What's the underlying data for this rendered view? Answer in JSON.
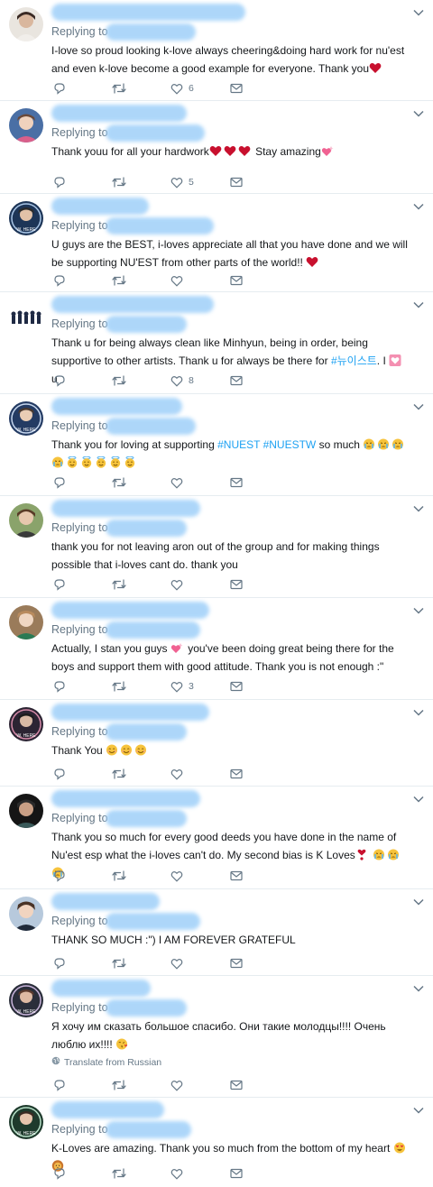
{
  "replying_to_label": "Replying to",
  "translate_label": "Translate from Russian",
  "tweets": [
    {
      "text": "I-love so proud looking k-love always cheering&doing hard work for nu'est and even k-love become a good example for everyone. Thank you",
      "like_count": "6"
    },
    {
      "text": "Thank youu for all your hardwork",
      "text_b": "Stay amazing",
      "like_count": "5"
    },
    {
      "text": "U guys are the BEST, i-loves appreciate all that you have done and we will be supporting NU'EST from other parts of the world!!",
      "like_count": ""
    },
    {
      "text": "Thank u for being always clean like Minhyun, being in order, being supportive to other artists. Thank u for always be there for",
      "hashtag": "#뉴이스트",
      "text_b": ". I",
      "text_c": "u",
      "like_count": "8"
    },
    {
      "text": "Thank you for loving at supporting",
      "hashtag": "#NUEST #NUESTW",
      "text_b": "so much",
      "like_count": ""
    },
    {
      "text": "thank you for not leaving aron out of the group and for making things possible that i-loves cant do. thank you",
      "like_count": ""
    },
    {
      "text": "Actually, I stan you guys",
      "text_b": "you've been doing great being there for the boys and support them with good attitude. Thank you is not enough :\"",
      "like_count": "3"
    },
    {
      "text": "Thank You",
      "like_count": ""
    },
    {
      "text": "Thank you so much for every good deeds you have done in the name of Nu'est esp what the i-loves can't do. My second bias is K Loves",
      "like_count": ""
    },
    {
      "text": "THANK SO MUCH :\") I AM FOREVER GRATEFUL",
      "like_count": ""
    },
    {
      "text": "Я хочу им сказать большое спасибо. Они такие молодцы!!!! Очень люблю их!!!!",
      "like_count": ""
    },
    {
      "text": "K-Loves are amazing. Thank you so much from the bottom of my heart",
      "like_count": ""
    }
  ],
  "colors": {
    "text": "#14171a",
    "secondary": "#657786",
    "link": "#1da1f2",
    "divider": "#e6ecf0",
    "redacted": "#9fd0f9",
    "heart_emoji": "#c8102e"
  },
  "icons": [
    "reply-icon",
    "retweet-icon",
    "like-icon",
    "dm-icon",
    "chevron-down-icon"
  ]
}
